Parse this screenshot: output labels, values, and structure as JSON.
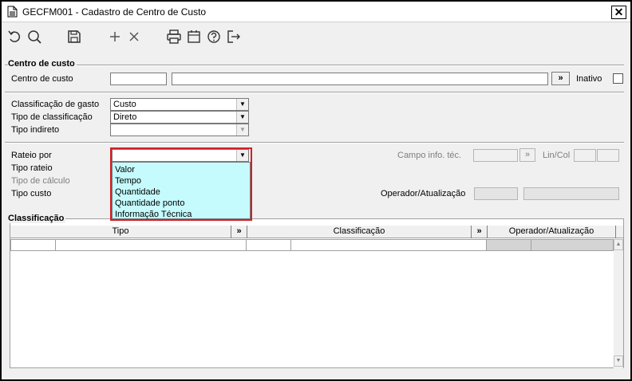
{
  "window": {
    "title": "GECFM001 - Cadastro de Centro de Custo",
    "close_glyph": "✕"
  },
  "toolbar": {
    "icons": [
      "undo-icon",
      "search-icon",
      "save-icon",
      "add-icon",
      "delete-icon",
      "print-icon",
      "calendar-icon",
      "help-icon",
      "exit-icon"
    ]
  },
  "centro_custo": {
    "section_title": "Centro de custo",
    "code_label": "Centro de custo",
    "code_value": "",
    "desc_value": "",
    "more_button": "»",
    "inativo_label": "Inativo"
  },
  "classificacao_gasto": {
    "label": "Classificação de gasto",
    "value": "Custo",
    "tipo_label": "Tipo de classificação",
    "tipo_value": "Direto",
    "indireto_label": "Tipo indireto",
    "indireto_value": ""
  },
  "rateio": {
    "rateio_label": "Rateio por",
    "rateio_value": "",
    "tipo_rateio_label": "Tipo rateio",
    "tipo_calculo_label": "Tipo de cálculo",
    "tipo_custo_label": "Tipo custo",
    "campo_info_label": "Campo info. téc.",
    "campo_info_button": "»",
    "lin_col_label": "Lin/Col",
    "operador_label": "Operador/Atualização",
    "options": [
      "Valor",
      "Tempo",
      "Quantidade",
      "Quantidade ponto",
      "Informação Técnica"
    ]
  },
  "classificacao_grid": {
    "section_title": "Classificação",
    "columns": [
      "Tipo",
      "»",
      "Classificação",
      "»",
      "Operador/Atualização"
    ]
  },
  "colors": {
    "highlight_border": "#d21f26",
    "dropdown_bg": "#c5fbfd"
  }
}
